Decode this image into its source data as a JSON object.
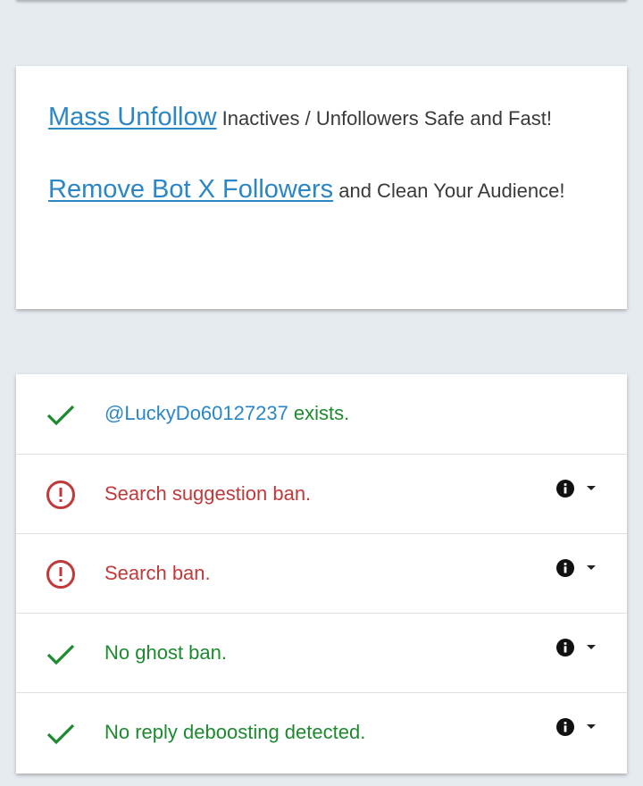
{
  "promo": {
    "mass_unfollow": {
      "link": "Mass Unfollow",
      "text": " Inactives / Unfollowers Safe and Fast!"
    },
    "remove_bots": {
      "link": "Remove Bot X Followers",
      "text": " and Clean Your Audience!"
    }
  },
  "results": {
    "exists": {
      "icon": "check-icon",
      "handle": "@LuckyDo60127237",
      "text": " exists."
    },
    "search_suggestion_ban": {
      "icon": "alert-circle-icon",
      "text": "Search suggestion ban."
    },
    "search_ban": {
      "icon": "alert-circle-icon",
      "text": "Search ban."
    },
    "ghost_ban": {
      "icon": "check-icon",
      "text": "No ghost ban."
    },
    "reply_deboosting": {
      "icon": "check-icon",
      "text": "No reply deboosting detected."
    }
  },
  "colors": {
    "background": "#e6ebef",
    "link": "#2b86c5",
    "ok_green": "#1c8a2e",
    "ban_red": "#c0393b"
  }
}
